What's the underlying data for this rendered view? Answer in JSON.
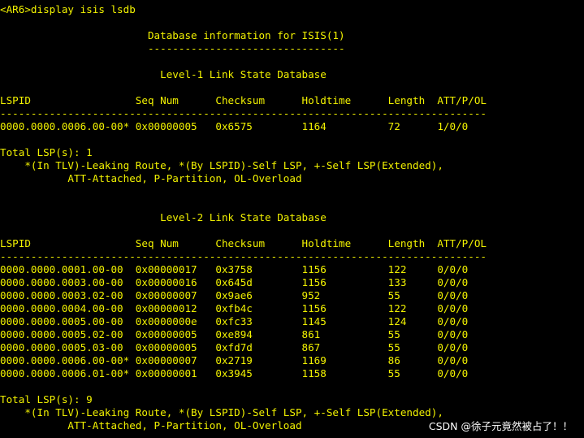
{
  "terminal": {
    "lines": [
      "<AR6>display isis lsdb",
      "",
      "                        Database information for ISIS(1)",
      "                        --------------------------------",
      "",
      "                          Level-1 Link State Database",
      "",
      "LSPID                 Seq Num      Checksum      Holdtime      Length  ATT/P/OL",
      "-------------------------------------------------------------------------------",
      "0000.0000.0006.00-00* 0x00000005   0x6575        1164          72      1/0/0",
      "",
      "Total LSP(s): 1",
      "    *(In TLV)-Leaking Route, *(By LSPID)-Self LSP, +-Self LSP(Extended),",
      "           ATT-Attached, P-Partition, OL-Overload",
      "",
      "",
      "                          Level-2 Link State Database",
      "",
      "LSPID                 Seq Num      Checksum      Holdtime      Length  ATT/P/OL",
      "-------------------------------------------------------------------------------",
      "0000.0000.0001.00-00  0x00000017   0x3758        1156          122     0/0/0",
      "0000.0000.0003.00-00  0x00000016   0x645d        1156          133     0/0/0",
      "0000.0000.0003.02-00  0x00000007   0x9ae6        952           55      0/0/0",
      "0000.0000.0004.00-00  0x00000012   0xfb4c        1156          122     0/0/0",
      "0000.0000.0005.00-00  0x0000000e   0xfc33        1145          124     0/0/0",
      "0000.0000.0005.02-00  0x00000005   0xe894        861           55      0/0/0",
      "0000.0000.0005.03-00  0x00000005   0xfd7d        867           55      0/0/0",
      "0000.0000.0006.00-00* 0x00000007   0x2719        1169          86      0/0/0",
      "0000.0000.0006.01-00* 0x00000001   0x3945        1158          55      0/0/0",
      "",
      "Total LSP(s): 9",
      "    *(In TLV)-Leaking Route, *(By LSPID)-Self LSP, +-Self LSP(Extended),",
      "           ATT-Attached, P-Partition, OL-Overload"
    ]
  },
  "watermark": "CSDN @徐子元竟然被占了！！",
  "colors": {
    "background": "#000000",
    "text": "#f2f200",
    "watermark": "#ffffff"
  }
}
